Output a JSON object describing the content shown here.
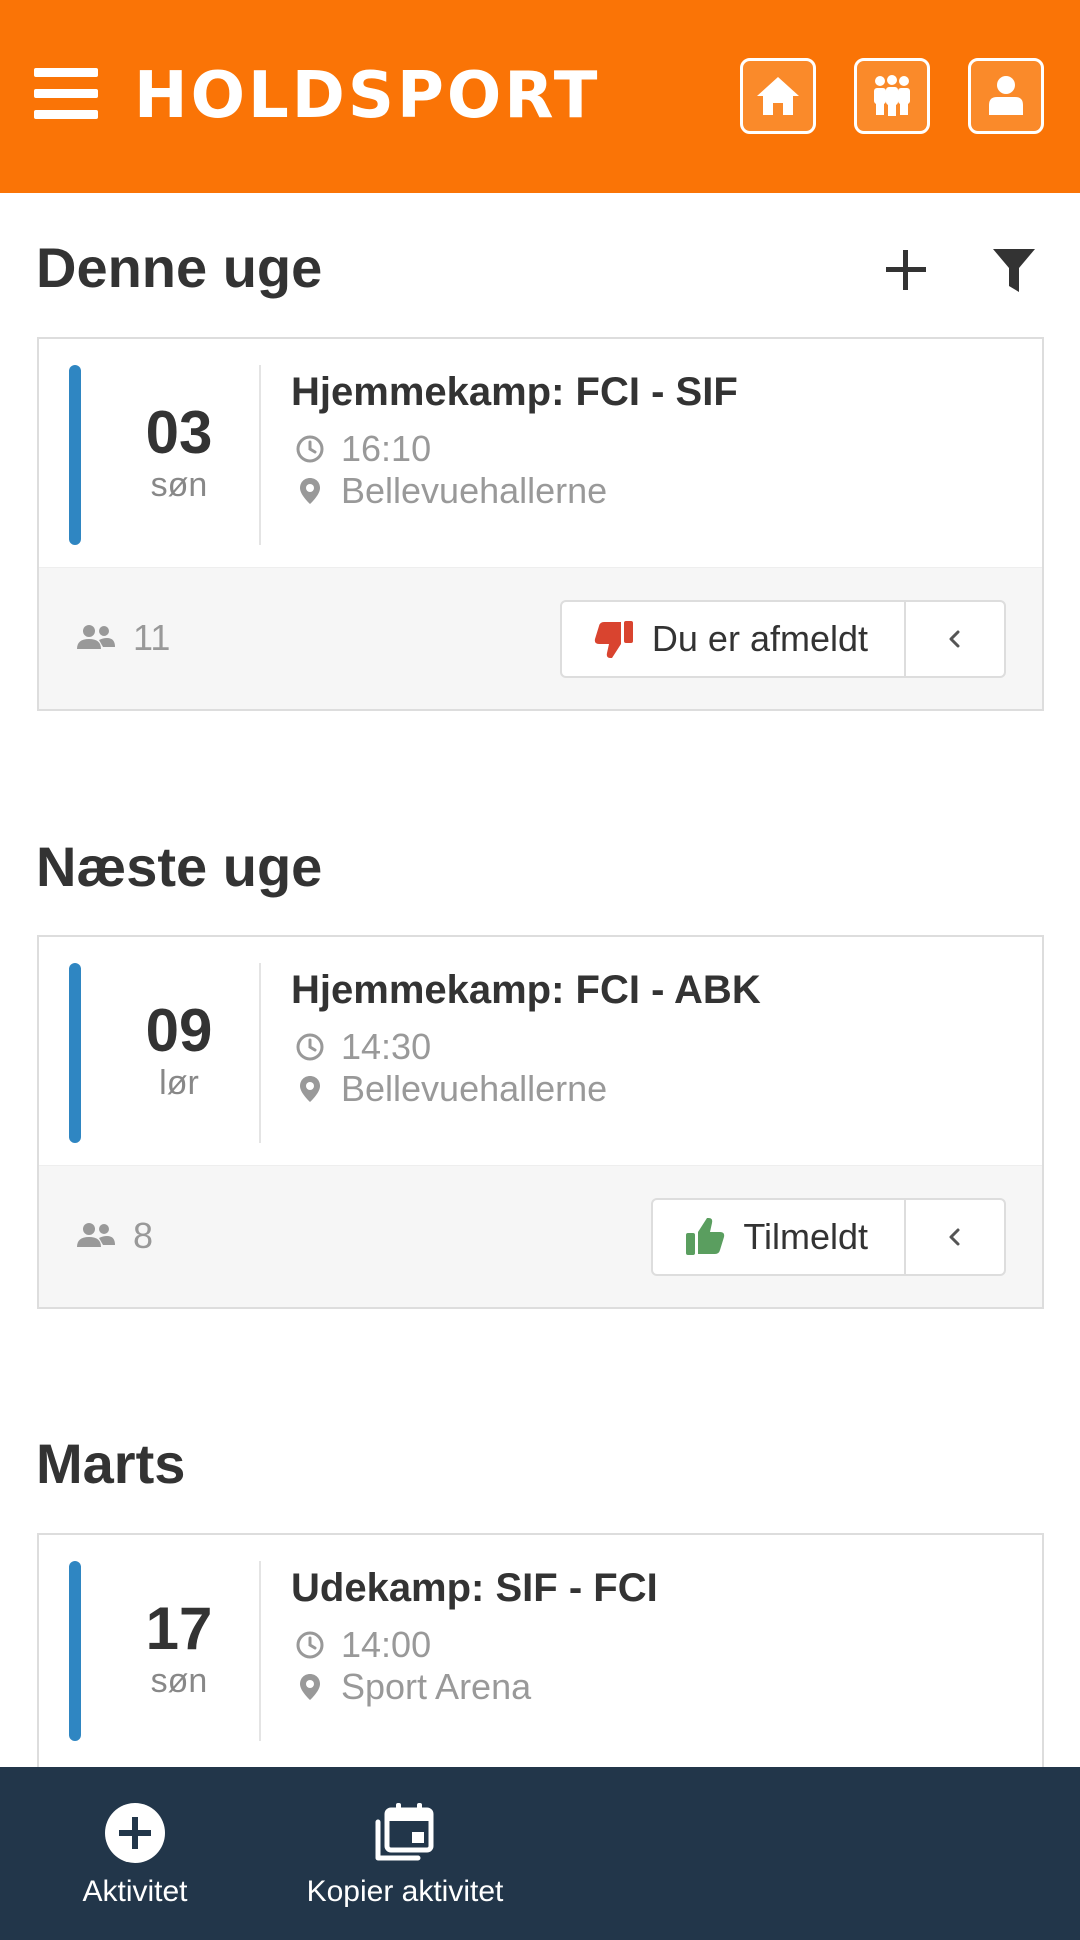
{
  "header": {
    "logo_text": "HOLDSPORT",
    "brand_color": "#fa7406",
    "menu_icon": "hamburger-icon",
    "buttons": [
      {
        "icon": "home-icon"
      },
      {
        "icon": "team-icon"
      },
      {
        "icon": "profile-icon"
      }
    ]
  },
  "sections": [
    {
      "title": "Denne uge",
      "actions": [
        {
          "icon": "plus-icon"
        },
        {
          "icon": "filter-icon"
        }
      ],
      "events": [
        {
          "date": "03",
          "day": "søn",
          "title": "Hjemmekamp: FCI - SIF",
          "time": "16:10",
          "location": "Bellevuehallerne",
          "participants": "11",
          "status": "Du er afmeldt",
          "status_type": "declined",
          "status_color": "#d9442f"
        }
      ]
    },
    {
      "title": "Næste uge",
      "events": [
        {
          "date": "09",
          "day": "lør",
          "title": "Hjemmekamp: FCI - ABK",
          "time": "14:30",
          "location": "Bellevuehallerne",
          "participants": "8",
          "status": "Tilmeldt",
          "status_type": "accepted",
          "status_color": "#5a9e5f"
        }
      ]
    },
    {
      "title": "Marts",
      "events": [
        {
          "date": "17",
          "day": "søn",
          "title": "Udekamp: SIF - FCI",
          "time": "14:00",
          "location": "Sport Arena"
        }
      ]
    }
  ],
  "bottom_bar": {
    "items": [
      {
        "label": "Aktivitet",
        "icon": "add-circle-icon"
      },
      {
        "label": "Kopier aktivitet",
        "icon": "copy-calendar-icon"
      }
    ]
  },
  "colors": {
    "accent_stripe": "#2f86c2",
    "bottom_bar": "#22364a"
  }
}
